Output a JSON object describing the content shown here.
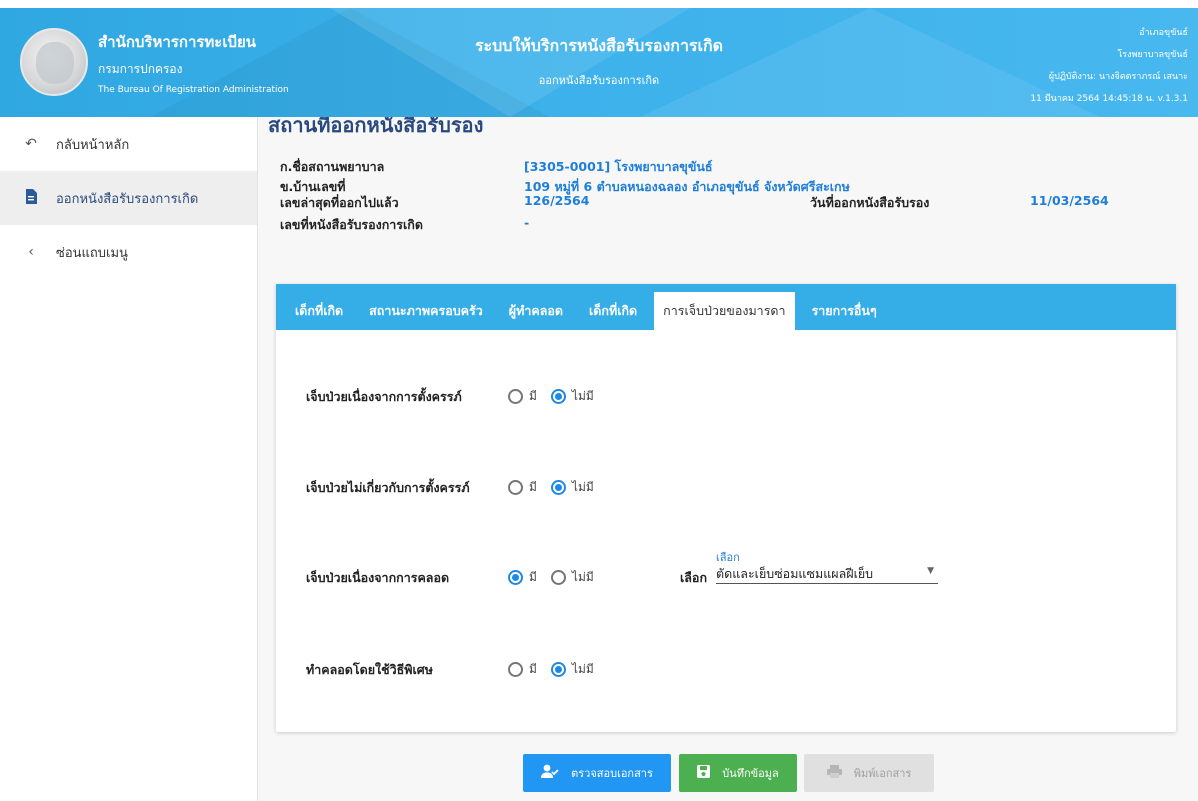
{
  "header": {
    "org_line1": "สำนักบริหารการทะเบียน",
    "org_line2": "กรมการปกครอง",
    "org_line3": "The Bureau Of Registration Administration",
    "system_title": "ระบบให้บริการหนังสือรับรองการเกิด",
    "system_subtitle": "ออกหนังสือรับรองการเกิด",
    "user_line1": "อำเภอขุขันธ์",
    "user_line2": "โรงพยาบาลขุขันธ์",
    "user_line3": "ผู้ปฏิบัติงาน: นางจิดตราภรณ์ เสนาะ",
    "user_line4": "11 มีนาคม 2564 14:45:18 น.  v.1.3.1"
  },
  "sidebar": {
    "items": [
      {
        "label": "กลับหน้าหลัก",
        "icon": "undo-icon"
      },
      {
        "label": "ออกหนังสือรับรองการเกิด",
        "icon": "document-icon"
      },
      {
        "label": "ซ่อนแถบเมนู",
        "icon": "chevron-left-icon"
      }
    ]
  },
  "page": {
    "title": "สถานที่ออกหนังสือรับรอง",
    "info": {
      "hospital_label": "ก.ชื่อสถานพยาบาล",
      "hospital_value": "[3305-0001] โรงพยาบาลขุขันธ์",
      "address_label": "ข.บ้านเลขที่",
      "address_value": "109 หมู่ที่ 6 ตำบลหนองฉลอง อำเภอขุขันธ์ จังหวัดศรีสะเกษ",
      "last_no_label": "เลขล่าสุดที่ออกไปแล้ว",
      "last_no_value": "126/2564",
      "issue_date_label": "วันที่ออกหนังสือรับรอง",
      "issue_date_value": "11/03/2564",
      "cert_no_label": "เลขที่หนังสือรับรองการเกิด",
      "cert_no_value": "-"
    }
  },
  "tabs": [
    {
      "label": "เด็กที่เกิด",
      "active": false
    },
    {
      "label": "สถานะภาพครอบครัว",
      "active": false
    },
    {
      "label": "ผู้ทำคลอด",
      "active": false
    },
    {
      "label": "เด็กที่เกิด",
      "active": false
    },
    {
      "label": "การเจ็บป่วยของมารดา",
      "active": true
    },
    {
      "label": "รายการอื่นๆ",
      "active": false
    }
  ],
  "form": {
    "option_yes": "มี",
    "option_no": "ไม่มี",
    "questions": [
      {
        "label": "เจ็บป่วยเนื่องจากการตั้งครรภ์",
        "selected": "ไม่มี"
      },
      {
        "label": "เจ็บป่วยไม่เกี่ยวกับการตั้งครรภ์",
        "selected": "ไม่มี"
      },
      {
        "label": "เจ็บป่วยเนื่องจากการคลอด",
        "selected": "มี"
      },
      {
        "label": "ทำคลอดโดยใช้วิธีพิเศษ",
        "selected": "ไม่มี"
      }
    ],
    "select": {
      "side_label": "เลือก",
      "floating_label": "เลือก",
      "value": "ตัดและเย็บซ่อมแซมแผลฝีเย็บ"
    }
  },
  "buttons": {
    "check": "ตรวจสอบเอกสาร",
    "save": "บันทึกข้อมูล",
    "print": "พิมพ์เอกสาร"
  },
  "colors": {
    "header": "#3bb0ea",
    "accent_blue": "#2196f3",
    "save_green": "#4caf50",
    "title_navy": "#2a4a7f"
  }
}
